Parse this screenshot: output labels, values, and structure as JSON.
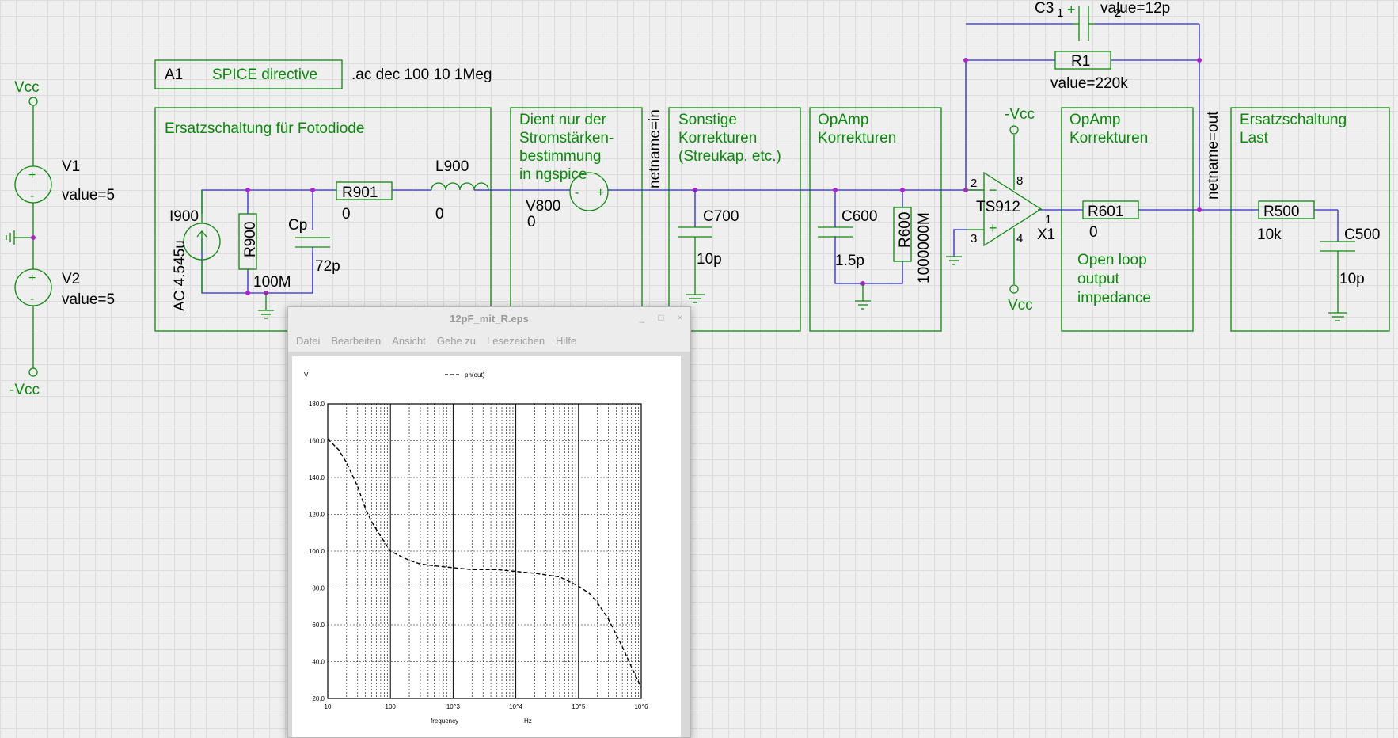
{
  "schematic": {
    "sources": {
      "vcc_top": "Vcc",
      "v1_name": "V1",
      "v1_value": "value=5",
      "v2_name": "V2",
      "v2_value": "value=5",
      "vcc_bottom": "-Vcc"
    },
    "spice": {
      "id": "A1",
      "label": "SPICE directive",
      "command": ".ac dec 100 10 1Meg"
    },
    "blocks": {
      "fotodiode": "Ersatzschaltung für Fotodiode",
      "ngspice": [
        "Dient nur der",
        "Stromstärken-",
        "bestimmung",
        "in ngspice"
      ],
      "sonstige": [
        "Sonstige",
        "Korrekturen",
        "(Streukap. etc.)"
      ],
      "opamp1": [
        "OpAmp",
        "Korrekturen"
      ],
      "opamp2": [
        "OpAmp",
        "Korrekturen"
      ],
      "last": [
        "Ersatzschaltung",
        "Last"
      ],
      "open_loop": [
        "Open loop",
        "output",
        "impedance"
      ]
    },
    "components": {
      "i900_name": "I900",
      "i900_value": "AC 4.545u",
      "r900_name": "R900",
      "r900_value": "100M",
      "cp_name": "Cp",
      "cp_value": "72p",
      "r901_name": "R901",
      "r901_value": "0",
      "l900_name": "L900",
      "l900_value": "0",
      "v800_name": "V800",
      "v800_value": "0",
      "netname_in": "netname=in",
      "c700_name": "C700",
      "c700_value": "10p",
      "c600_name": "C600",
      "c600_value": "1.5p",
      "r600_name": "R600",
      "r600_value": "1000000M",
      "opamp_vneg": "-Vcc",
      "opamp_vpos": "Vcc",
      "opamp_name": "TS912",
      "opamp_ref": "X1",
      "pin2": "2",
      "pin3": "3",
      "pin8": "8",
      "pin4": "4",
      "pin1": "1",
      "c3_name": "C3",
      "c3_pin1": "1",
      "c3_pin2": "2",
      "c3_value": "value=12p",
      "r1_name": "R1",
      "r1_value": "value=220k",
      "r601_name": "R601",
      "r601_value": "0",
      "netname_out": "netname=out",
      "r500_name": "R500",
      "r500_value": "10k",
      "c500_name": "C500",
      "c500_value": "10p"
    }
  },
  "viewer": {
    "title": "12pF_mit_R.eps",
    "buttons": [
      "_",
      "□",
      "×"
    ],
    "menu": [
      "Datei",
      "Bearbeiten",
      "Ansicht",
      "Gehe zu",
      "Lesezeichen",
      "Hilfe"
    ]
  },
  "chart_data": {
    "type": "line",
    "title": "",
    "ylabel": "V",
    "xlabel": "frequency",
    "xunit": "Hz",
    "xscale": "log",
    "xlim": [
      10,
      1000000
    ],
    "ylim": [
      20,
      180
    ],
    "yticks": [
      "20.0",
      "40.0",
      "60.0",
      "80.0",
      "100.0",
      "120.0",
      "140.0",
      "160.0",
      "180.0"
    ],
    "xticks": [
      "10",
      "100",
      "10^3",
      "10^4",
      "10^5",
      "10^6"
    ],
    "grid": true,
    "legend_position": "top",
    "series": [
      {
        "name": "ph(out)",
        "style": "dashed",
        "x": [
          10,
          15,
          20,
          30,
          40,
          50,
          70,
          100,
          150,
          200,
          300,
          500,
          1000,
          2000,
          5000,
          10000,
          20000,
          50000,
          100000,
          150000,
          200000,
          300000,
          500000,
          700000,
          1000000
        ],
        "y": [
          161,
          155,
          148,
          135,
          123,
          116,
          108,
          100,
          97,
          95,
          93,
          92,
          91,
          90,
          90,
          89,
          88,
          86,
          81,
          77,
          72,
          63,
          48,
          37,
          26
        ]
      }
    ]
  }
}
